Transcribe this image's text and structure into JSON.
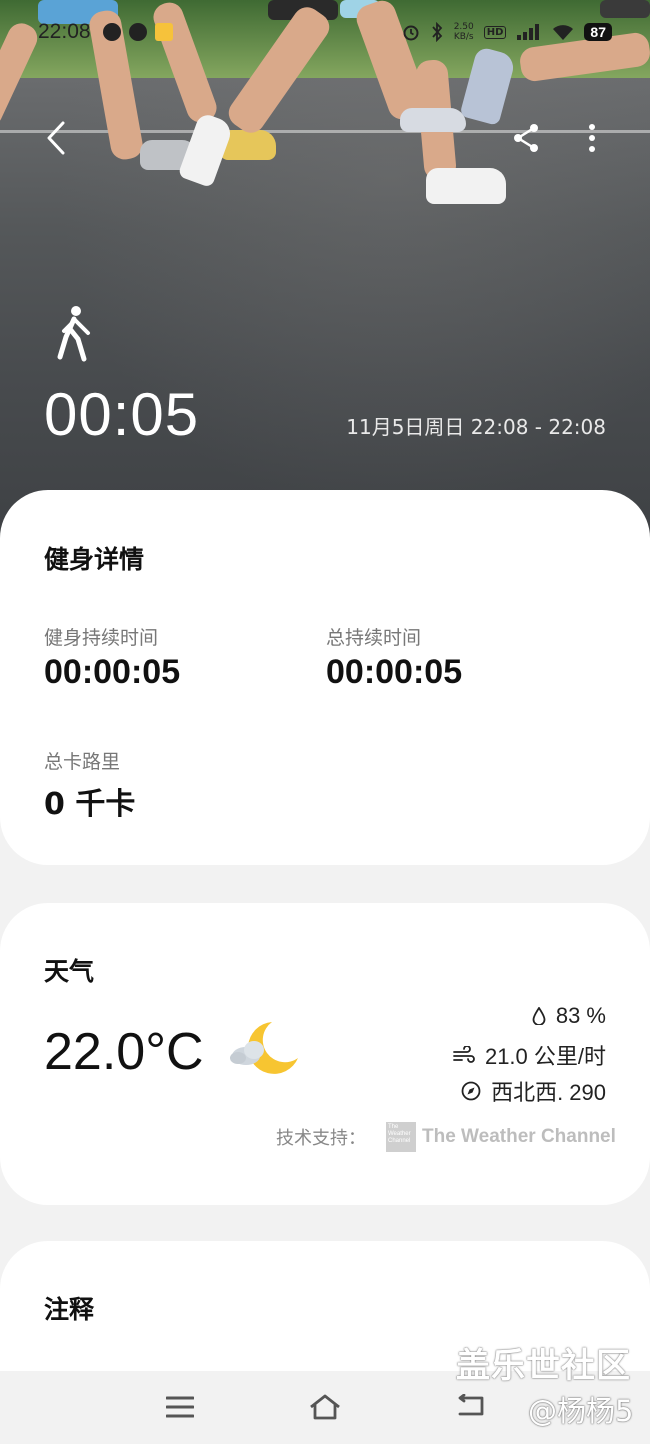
{
  "status_bar": {
    "time": "22:08",
    "net_speed": "2.50\nKB/s",
    "hd": "HD",
    "network": "4G",
    "battery": "87"
  },
  "hero": {
    "activity_icon": "walking-icon",
    "duration": "00:05",
    "date_range": "11月5日周日 22:08 - 22:08"
  },
  "fitness": {
    "title": "健身详情",
    "workout_duration_label": "健身持续时间",
    "workout_duration_value": "00:00:05",
    "total_duration_label": "总持续时间",
    "total_duration_value": "00:00:05",
    "calories_label": "总卡路里",
    "calories_value": "0 千卡"
  },
  "weather": {
    "title": "天气",
    "temperature": "22.0°C",
    "condition_icon": "partly-cloudy-night-icon",
    "humidity": "83 %",
    "wind_speed": "21.0 公里/时",
    "wind_direction": "西北西. 290",
    "support_label": "技术支持：",
    "provider": "The Weather Channel",
    "provider_logo_text": "The Weather Channel"
  },
  "notes": {
    "title": "注释"
  },
  "watermark": {
    "line1": "盖乐世社区",
    "line2": "@杨杨5"
  },
  "colors": {
    "card_bg": "#ffffff",
    "page_bg": "#f2f2f2",
    "moon": "#f7c531",
    "text_primary": "#111111",
    "text_secondary": "#777777"
  }
}
